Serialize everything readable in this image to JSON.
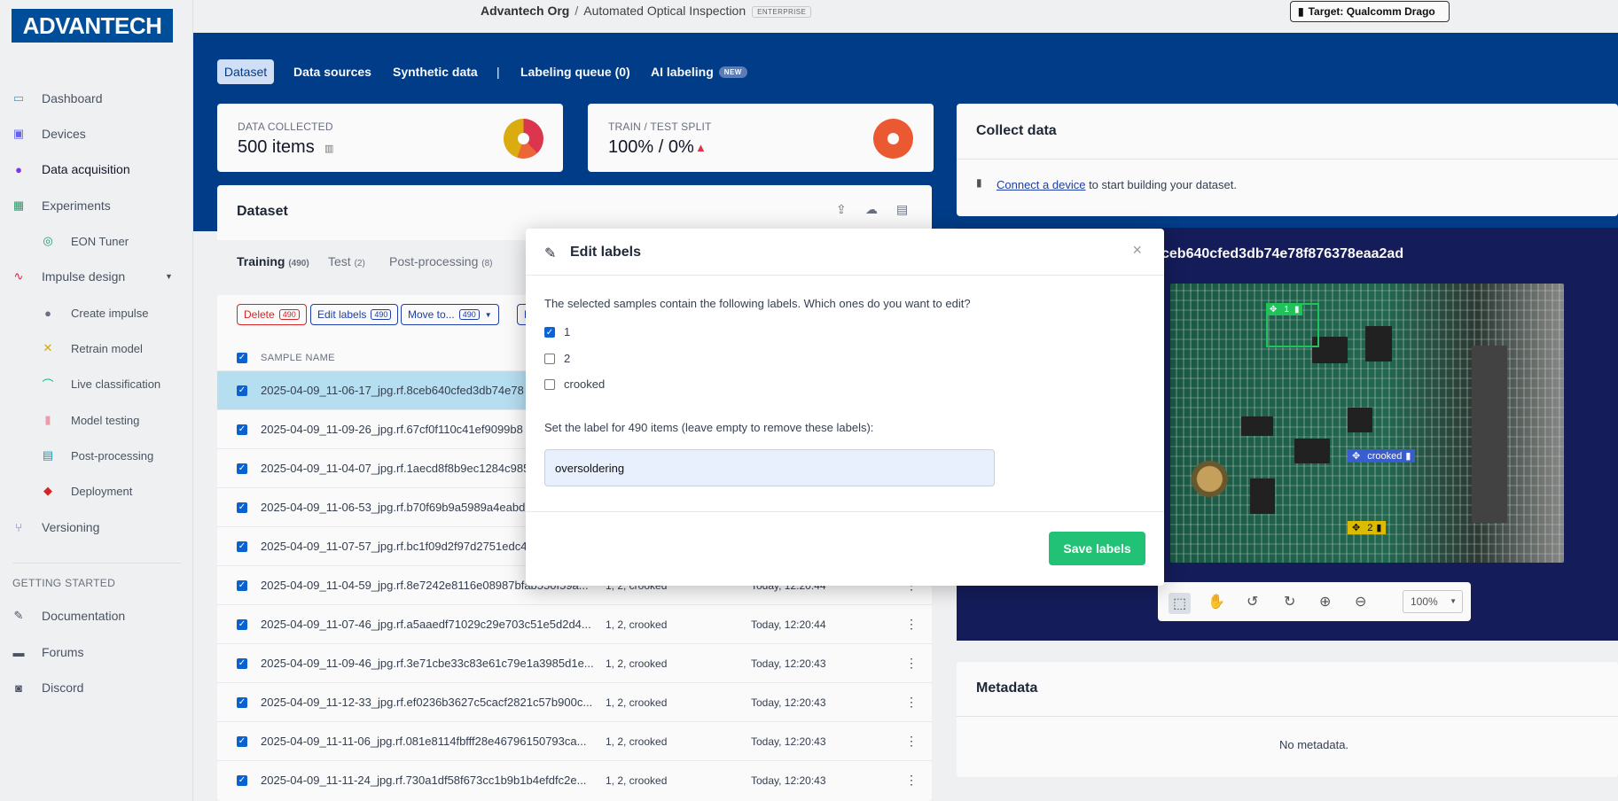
{
  "brand": {
    "logo_text": "ADVANTECH",
    "accent": "#00509e"
  },
  "sidebar": {
    "items": [
      {
        "label": "Dashboard",
        "icon": "monitor-icon"
      },
      {
        "label": "Devices",
        "icon": "chip-icon"
      },
      {
        "label": "Data acquisition",
        "icon": "database-icon"
      },
      {
        "label": "Experiments",
        "icon": "grid-icon"
      },
      {
        "label": "EON Tuner",
        "icon": "tuner-icon"
      },
      {
        "label": "Impulse design",
        "icon": "pulse-icon"
      },
      {
        "label": "Create impulse",
        "icon": "dot-icon"
      },
      {
        "label": "Retrain model",
        "icon": "shuffle-icon"
      },
      {
        "label": "Live classification",
        "icon": "live-icon"
      },
      {
        "label": "Model testing",
        "icon": "clipboard-icon"
      },
      {
        "label": "Post-processing",
        "icon": "doc-icon"
      },
      {
        "label": "Deployment",
        "icon": "cube-icon"
      },
      {
        "label": "Versioning",
        "icon": "branch-icon"
      }
    ],
    "getting_started": "GETTING STARTED",
    "help": [
      {
        "label": "Documentation",
        "icon": "book-icon"
      },
      {
        "label": "Forums",
        "icon": "chat-icon"
      },
      {
        "label": "Discord",
        "icon": "discord-icon"
      }
    ]
  },
  "header": {
    "org": "Advantech Org",
    "sep": "/",
    "project": "Automated Optical Inspection",
    "badge": "ENTERPRISE",
    "target": "Target: Qualcomm Drago"
  },
  "tabs": {
    "dataset": "Dataset",
    "sources": "Data sources",
    "synthetic": "Synthetic data",
    "divider": "|",
    "queue": "Labeling queue (0)",
    "ai": "AI labeling",
    "ai_badge": "NEW"
  },
  "stats": {
    "collected_label": "DATA COLLECTED",
    "collected_value": "500 items",
    "split_label": "TRAIN / TEST SPLIT",
    "split_value": "100% / 0%"
  },
  "dataset": {
    "title": "Dataset",
    "tabs": {
      "training": "Training",
      "training_count": "(490)",
      "test": "Test",
      "test_count": "(2)",
      "post": "Post-processing",
      "post_count": "(8)"
    },
    "actions": {
      "delete": "Delete",
      "edit": "Edit labels",
      "move": "Move to...",
      "count": "490",
      "e": "E"
    },
    "col_name": "SAMPLE NAME",
    "rows": [
      {
        "name": "2025-04-09_11-06-17_jpg.rf.8ceb640cfed3db74e78",
        "labels": "",
        "date": ""
      },
      {
        "name": "2025-04-09_11-09-26_jpg.rf.67cf0f110c41ef9099b8",
        "labels": "",
        "date": ""
      },
      {
        "name": "2025-04-09_11-04-07_jpg.rf.1aecd8f8b9ec1284c985",
        "labels": "",
        "date": ""
      },
      {
        "name": "2025-04-09_11-06-53_jpg.rf.b70f69b9a5989a4eabd",
        "labels": "",
        "date": ""
      },
      {
        "name": "2025-04-09_11-07-57_jpg.rf.bc1f09d2f97d2751edc4",
        "labels": "",
        "date": ""
      },
      {
        "name": "2025-04-09_11-04-59_jpg.rf.8e7242e8116e08987bfab550f59a...",
        "labels": "1, 2, crooked",
        "date": "Today, 12:20:44"
      },
      {
        "name": "2025-04-09_11-07-46_jpg.rf.a5aaedf71029c29e703c51e5d2d4...",
        "labels": "1, 2, crooked",
        "date": "Today, 12:20:44"
      },
      {
        "name": "2025-04-09_11-09-46_jpg.rf.3e71cbe33c83e61c79e1a3985d1e...",
        "labels": "1, 2, crooked",
        "date": "Today, 12:20:43"
      },
      {
        "name": "2025-04-09_11-12-33_jpg.rf.ef0236b3627c5cacf2821c57b900c...",
        "labels": "1, 2, crooked",
        "date": "Today, 12:20:43"
      },
      {
        "name": "2025-04-09_11-11-06_jpg.rf.081e8114fbfff28e46796150793ca...",
        "labels": "1, 2, crooked",
        "date": "Today, 12:20:43"
      },
      {
        "name": "2025-04-09_11-11-24_jpg.rf.730a1df58f673cc1b9b1b4efdfc2e...",
        "labels": "1, 2, crooked",
        "date": "Today, 12:20:43"
      }
    ]
  },
  "collect": {
    "title": "Collect data",
    "link": "Connect a device",
    "rest": " to start building your dataset."
  },
  "viewer": {
    "sample_title": "ceb640cfed3db74e78f876378eaa2ad",
    "box_label_1": "1",
    "box_label_crooked": "crooked",
    "box_label_2": "2",
    "zoom": "100%"
  },
  "metadata": {
    "title": "Metadata",
    "empty": "No metadata."
  },
  "modal": {
    "title": "Edit labels",
    "prompt": "The selected samples contain the following labels. Which ones do you want to edit?",
    "options": [
      {
        "label": "1",
        "checked": true
      },
      {
        "label": "2",
        "checked": false
      },
      {
        "label": "crooked",
        "checked": false
      }
    ],
    "set_prompt": "Set the label for 490 items (leave empty to remove these labels):",
    "input_value": "oversoldering",
    "save": "Save labels"
  }
}
